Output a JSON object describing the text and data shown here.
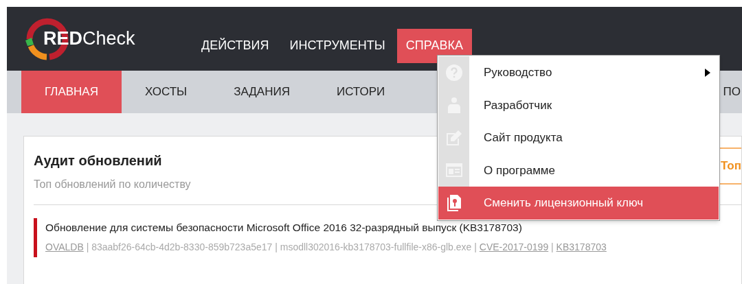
{
  "logo": {
    "brand": "RED",
    "product": "Check"
  },
  "top_menu": [
    {
      "label": "ДЕЙСТВИЯ",
      "selected": false
    },
    {
      "label": "ИНСТРУМЕНТЫ",
      "selected": false
    },
    {
      "label": "СПРАВКА",
      "selected": true
    }
  ],
  "tabs": [
    {
      "label": "ГЛАВНАЯ",
      "selected": true
    },
    {
      "label": "ХОСТЫ",
      "selected": false
    },
    {
      "label": "ЗАДАНИЯ",
      "selected": false
    },
    {
      "label": "ИСТОРИ",
      "selected": false
    },
    {
      "label": "ПО",
      "selected": false
    }
  ],
  "dropdown": [
    {
      "kind": "help",
      "label": "Руководство",
      "submenu": true,
      "selected": false
    },
    {
      "kind": "person",
      "label": "Разработчик",
      "submenu": false,
      "selected": false
    },
    {
      "kind": "edit",
      "label": "Сайт продукта",
      "submenu": false,
      "selected": false
    },
    {
      "kind": "window",
      "label": "О программе",
      "submenu": false,
      "selected": false
    },
    {
      "kind": "license",
      "label": "Сменить лицензионный ключ",
      "submenu": false,
      "selected": true
    }
  ],
  "card": {
    "title": "Аудит обновлений",
    "subtitle": "Топ обновлений по количеству",
    "side_button": "Топ",
    "entries": [
      {
        "separator": "|",
        "title": "Обновление для системы безопасности Microsoft Office 2016 32-разрядный выпуск (KB3178703)",
        "meta": [
          {
            "text": "OVALDB",
            "link": true
          },
          {
            "text": "83aabf26-64cb-4d2b-8330-859b723a5e17",
            "link": false
          },
          {
            "text": "msodll302016-kb3178703-fullfile-x86-glb.exe",
            "link": false
          },
          {
            "text": "CVE-2017-0199",
            "link": true
          },
          {
            "text": "KB3178703",
            "link": true
          }
        ]
      }
    ]
  }
}
